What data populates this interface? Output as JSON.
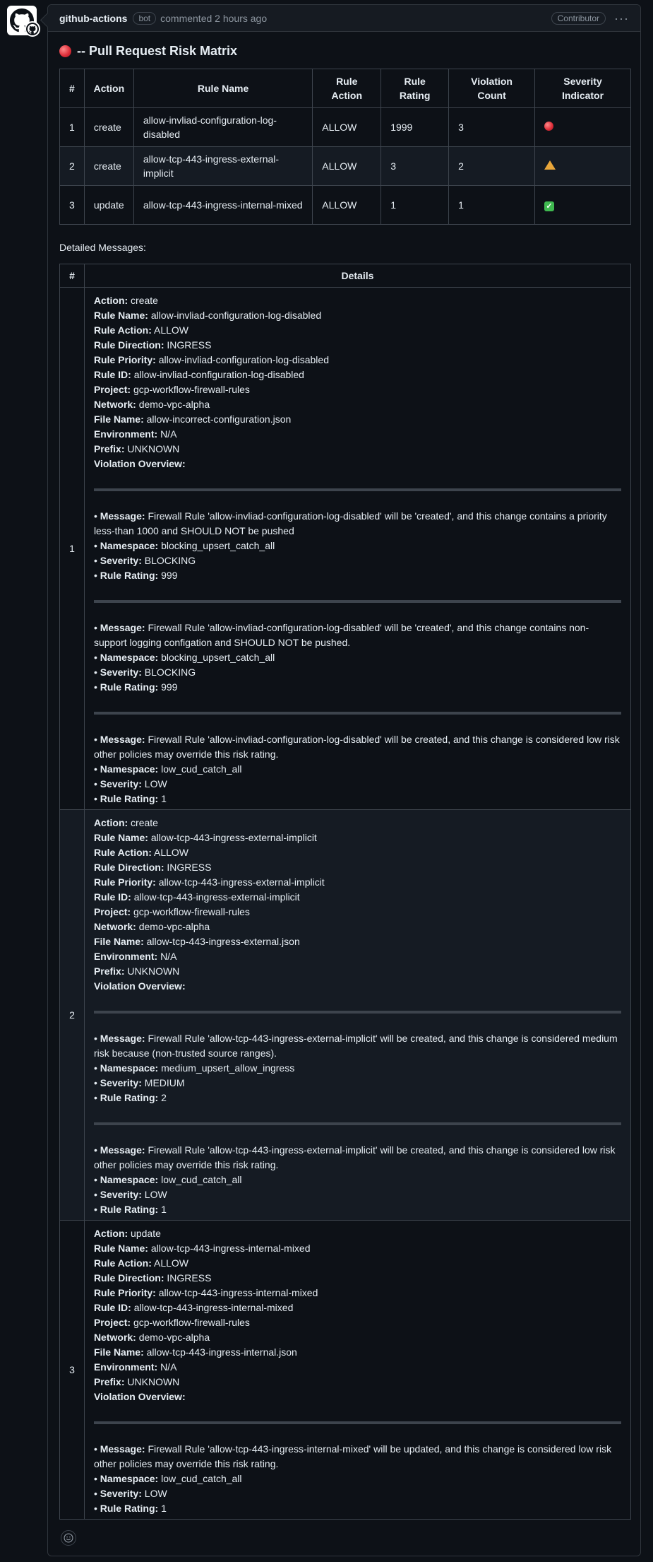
{
  "comment": {
    "author": "github-actions",
    "bot_label": "bot",
    "commented_text": "commented 2 hours ago",
    "role_badge": "Contributor"
  },
  "title": "-- Pull Request Risk Matrix",
  "matrix": {
    "headers": [
      "#",
      "Action",
      "Rule Name",
      "Rule Action",
      "Rule Rating",
      "Violation Count",
      "Severity Indicator"
    ],
    "rows": [
      {
        "num": "1",
        "action": "create",
        "rule_name": "allow-invliad-configuration-log-disabled",
        "rule_action": "ALLOW",
        "rating": "1999",
        "count": "3",
        "severity": "red-circle"
      },
      {
        "num": "2",
        "action": "create",
        "rule_name": "allow-tcp-443-ingress-external-implicit",
        "rule_action": "ALLOW",
        "rating": "3",
        "count": "2",
        "severity": "warning"
      },
      {
        "num": "3",
        "action": "update",
        "rule_name": "allow-tcp-443-ingress-internal-mixed",
        "rule_action": "ALLOW",
        "rating": "1",
        "count": "1",
        "severity": "check"
      }
    ]
  },
  "detailed_label": "Detailed Messages:",
  "details_headers": [
    "#",
    "Details"
  ],
  "field_labels": {
    "action": "Action:",
    "rule_name": "Rule Name:",
    "rule_action": "Rule Action:",
    "rule_direction": "Rule Direction:",
    "rule_priority": "Rule Priority:",
    "rule_id": "Rule ID:",
    "project": "Project:",
    "network": "Network:",
    "file_name": "File Name:",
    "environment": "Environment:",
    "prefix": "Prefix:",
    "violation_overview": "Violation Overview:",
    "message": "Message:",
    "namespace": "Namespace:",
    "severity": "Severity:",
    "rule_rating": "Rule Rating:"
  },
  "details": [
    {
      "num": "1",
      "action": "create",
      "rule_name": "allow-invliad-configuration-log-disabled",
      "rule_action": "ALLOW",
      "rule_direction": "INGRESS",
      "rule_priority": "allow-invliad-configuration-log-disabled",
      "rule_id": "allow-invliad-configuration-log-disabled",
      "project": "gcp-workflow-firewall-rules",
      "network": "demo-vpc-alpha",
      "file_name": "allow-incorrect-configuration.json",
      "environment": "N/A",
      "prefix": "UNKNOWN",
      "violations": [
        {
          "message": "Firewall Rule 'allow-invliad-configuration-log-disabled' will be 'created', and this change contains a priority less-than 1000 and SHOULD NOT be pushed",
          "namespace": "blocking_upsert_catch_all",
          "severity": "BLOCKING",
          "rating": "999"
        },
        {
          "message": "Firewall Rule 'allow-invliad-configuration-log-disabled' will be 'created', and this change contains non-support logging configation and SHOULD NOT be pushed.",
          "namespace": "blocking_upsert_catch_all",
          "severity": "BLOCKING",
          "rating": "999"
        },
        {
          "message": "Firewall Rule 'allow-invliad-configuration-log-disabled' will be created, and this change is considered low risk other policies may override this risk rating.",
          "namespace": "low_cud_catch_all",
          "severity": "LOW",
          "rating": "1"
        }
      ]
    },
    {
      "num": "2",
      "action": "create",
      "rule_name": "allow-tcp-443-ingress-external-implicit",
      "rule_action": "ALLOW",
      "rule_direction": "INGRESS",
      "rule_priority": "allow-tcp-443-ingress-external-implicit",
      "rule_id": "allow-tcp-443-ingress-external-implicit",
      "project": "gcp-workflow-firewall-rules",
      "network": "demo-vpc-alpha",
      "file_name": "allow-tcp-443-ingress-external.json",
      "environment": "N/A",
      "prefix": "UNKNOWN",
      "violations": [
        {
          "message": "Firewall Rule 'allow-tcp-443-ingress-external-implicit' will be created, and this change is considered medium risk because (non-trusted source ranges).",
          "namespace": "medium_upsert_allow_ingress",
          "severity": "MEDIUM",
          "rating": "2"
        },
        {
          "message": "Firewall Rule 'allow-tcp-443-ingress-external-implicit' will be created, and this change is considered low risk other policies may override this risk rating.",
          "namespace": "low_cud_catch_all",
          "severity": "LOW",
          "rating": "1"
        }
      ]
    },
    {
      "num": "3",
      "action": "update",
      "rule_name": "allow-tcp-443-ingress-internal-mixed",
      "rule_action": "ALLOW",
      "rule_direction": "INGRESS",
      "rule_priority": "allow-tcp-443-ingress-internal-mixed",
      "rule_id": "allow-tcp-443-ingress-internal-mixed",
      "project": "gcp-workflow-firewall-rules",
      "network": "demo-vpc-alpha",
      "file_name": "allow-tcp-443-ingress-internal.json",
      "environment": "N/A",
      "prefix": "UNKNOWN",
      "violations": [
        {
          "message": "Firewall Rule 'allow-tcp-443-ingress-internal-mixed' will be updated, and this change is considered low risk other policies may override this risk rating.",
          "namespace": "low_cud_catch_all",
          "severity": "LOW",
          "rating": "1"
        }
      ]
    }
  ]
}
